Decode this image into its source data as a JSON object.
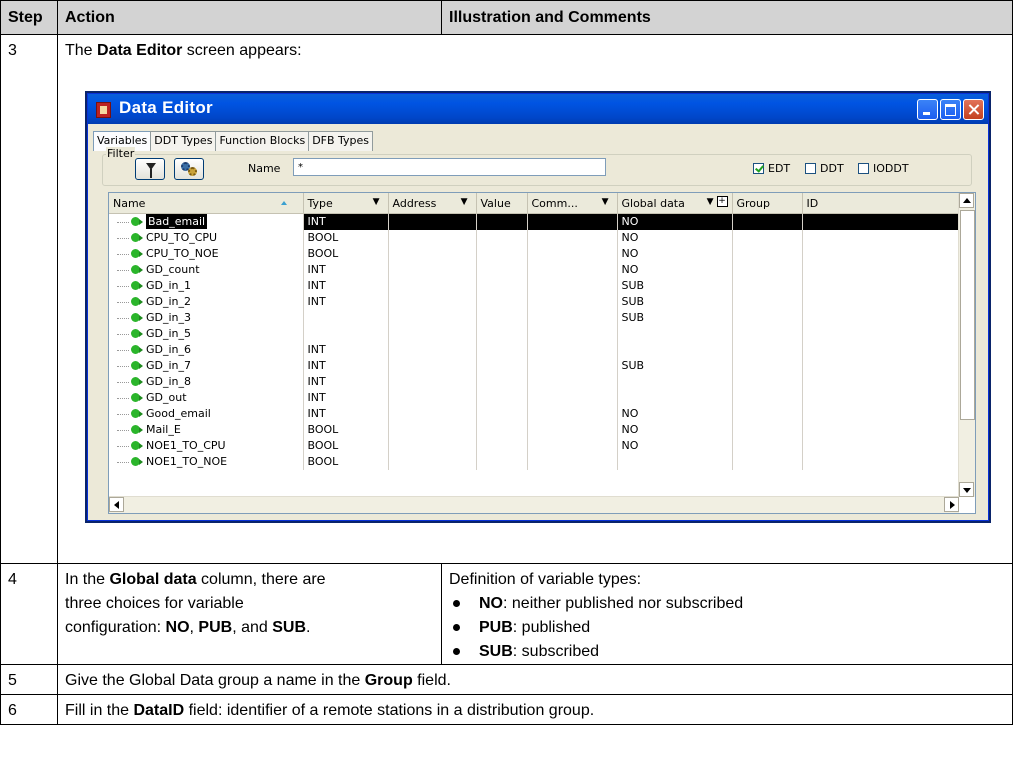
{
  "headers": {
    "step": "Step",
    "action": "Action",
    "illustration": "Illustration and Comments"
  },
  "row3": {
    "step": "3",
    "text_before": "The ",
    "text_bold": "Data Editor",
    "text_after": " screen appears:"
  },
  "editor": {
    "title": "Data Editor",
    "tabs": [
      "Variables",
      "DDT Types",
      "Function Blocks",
      "DFB Types"
    ],
    "filter": {
      "label": "Filter",
      "name_label": "Name",
      "name_value": "*",
      "checkboxes": [
        {
          "label": "EDT",
          "checked": true
        },
        {
          "label": "DDT",
          "checked": false
        },
        {
          "label": "IODDT",
          "checked": false
        }
      ]
    },
    "columns": [
      "Name",
      "Type",
      "Address",
      "Value",
      "Comm...",
      "Global data",
      "Group",
      "ID"
    ],
    "rows": [
      {
        "name": "Bad_email",
        "type": "INT",
        "global": "NO",
        "selected": true
      },
      {
        "name": "CPU_TO_CPU",
        "type": "BOOL",
        "global": "NO"
      },
      {
        "name": "CPU_TO_NOE",
        "type": "BOOL",
        "global": "NO"
      },
      {
        "name": "GD_count",
        "type": "INT",
        "global": "NO"
      },
      {
        "name": "GD_in_1",
        "type": "INT",
        "global": "SUB"
      },
      {
        "name": "GD_in_2",
        "type": "INT",
        "global": "SUB"
      },
      {
        "name": "GD_in_3",
        "type": "",
        "global": "SUB"
      },
      {
        "name": "GD_in_5",
        "type": "",
        "global": ""
      },
      {
        "name": "GD_in_6",
        "type": "INT",
        "global": ""
      },
      {
        "name": "GD_in_7",
        "type": "INT",
        "global": "SUB"
      },
      {
        "name": "GD_in_8",
        "type": "INT",
        "global": ""
      },
      {
        "name": "GD_out",
        "type": "INT",
        "global": ""
      },
      {
        "name": "Good_email",
        "type": "INT",
        "global": "NO"
      },
      {
        "name": "Mail_E",
        "type": "BOOL",
        "global": "NO"
      },
      {
        "name": "NOE1_TO_CPU",
        "type": "BOOL",
        "global": "NO"
      },
      {
        "name": "NOE1_TO_NOE",
        "type": "BOOL",
        "global": ""
      }
    ]
  },
  "row4": {
    "step": "4",
    "a1": "In the ",
    "a1_bold": "Global data",
    "a1_after": " column, there are",
    "a2": "three choices for variable",
    "a3": "configuration: ",
    "a3_b1": "NO",
    "a3_s1": ", ",
    "a3_b2": "PUB",
    "a3_s2": ", and ",
    "a3_b3": "SUB",
    "a3_end": ".",
    "c_intro": "Definition of variable types:",
    "bullets": [
      {
        "term": "NO",
        "desc": ": neither published nor subscribed"
      },
      {
        "term": "PUB",
        "desc": ": published"
      },
      {
        "term": "SUB",
        "desc": ": subscribed"
      }
    ]
  },
  "row5": {
    "step": "5",
    "before": "Give the Global Data group a name in the ",
    "bold": "Group",
    "after": " field."
  },
  "row6": {
    "step": "6",
    "before": "Fill in the ",
    "bold": "DataID",
    "after": " field: identifier of a remote stations in a distribution group."
  }
}
